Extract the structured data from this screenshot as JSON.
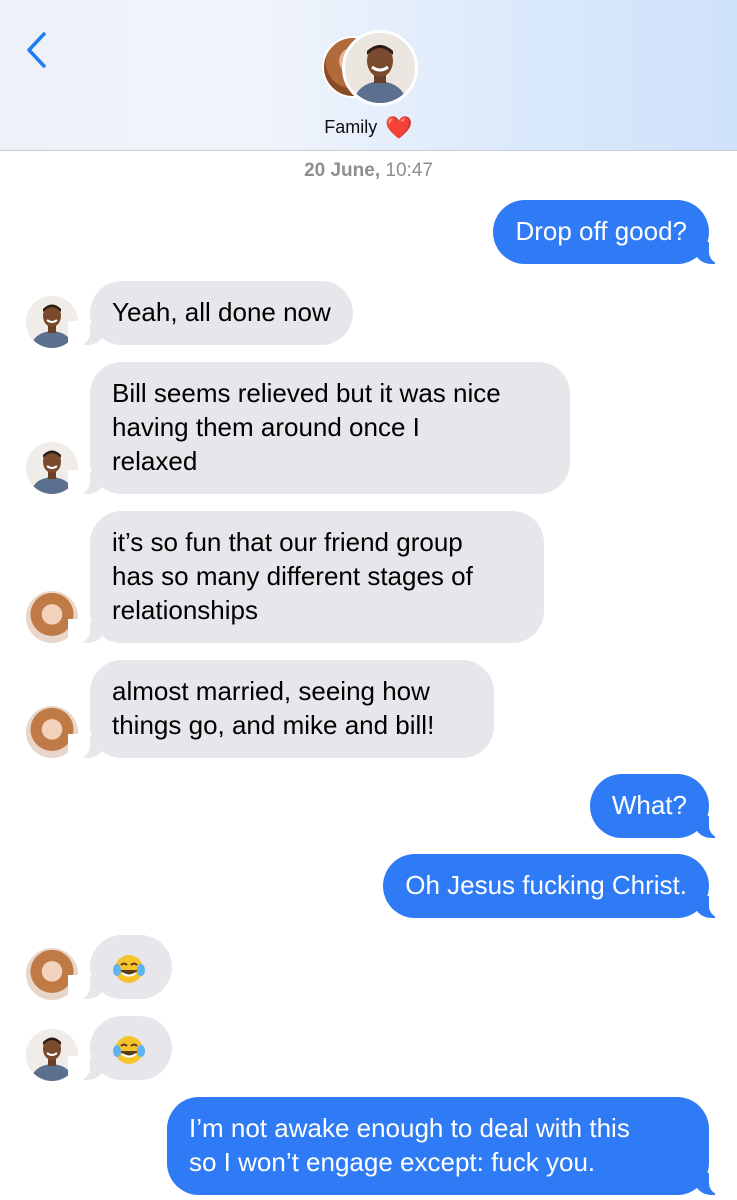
{
  "header": {
    "group_name": "Family",
    "heart": "❤️"
  },
  "timestamp": {
    "date": "20 June,",
    "time": "10:47"
  },
  "messages": [
    {
      "from": "me",
      "text": "Drop off good?"
    },
    {
      "from": "man",
      "text": "Yeah, all done now"
    },
    {
      "from": "man",
      "text": "Bill seems relieved but it was nice having them around once I relaxed",
      "lines": [
        "Bill seems relieved but it was nice",
        "having them around once I",
        "relaxed"
      ]
    },
    {
      "from": "woman",
      "text": "it’s so fun that our friend group has so many different stages of relationships",
      "lines": [
        "it’s so fun that our friend group",
        "has so many different stages of",
        "relationships"
      ]
    },
    {
      "from": "woman",
      "text": "almost married, seeing how things go, and mike and bill!",
      "lines": [
        "almost married, seeing how",
        "things go, and mike and bill!"
      ]
    },
    {
      "from": "me",
      "text": "What?"
    },
    {
      "from": "me",
      "text": "Oh Jesus fucking Christ."
    },
    {
      "from": "woman",
      "text": "",
      "emoji": "face-with-tears-of-joy"
    },
    {
      "from": "man",
      "text": "",
      "emoji": "face-with-tears-of-joy"
    },
    {
      "from": "me",
      "text": "I’m not awake enough to deal with this so I won’t engage except: fuck you.",
      "lines": [
        "I’m not awake enough to deal with this",
        "so I won’t engage except: fuck you."
      ]
    }
  ],
  "colors": {
    "outgoing_bubble": "#2f7bf6",
    "incoming_bubble": "#e6e6eb",
    "accent": "#1f7cf2",
    "timestamp": "#8e8e93",
    "heart": "#e0212f"
  },
  "icons": {
    "back": "chevron-left-icon",
    "reaction": "face-with-tears-of-joy"
  }
}
